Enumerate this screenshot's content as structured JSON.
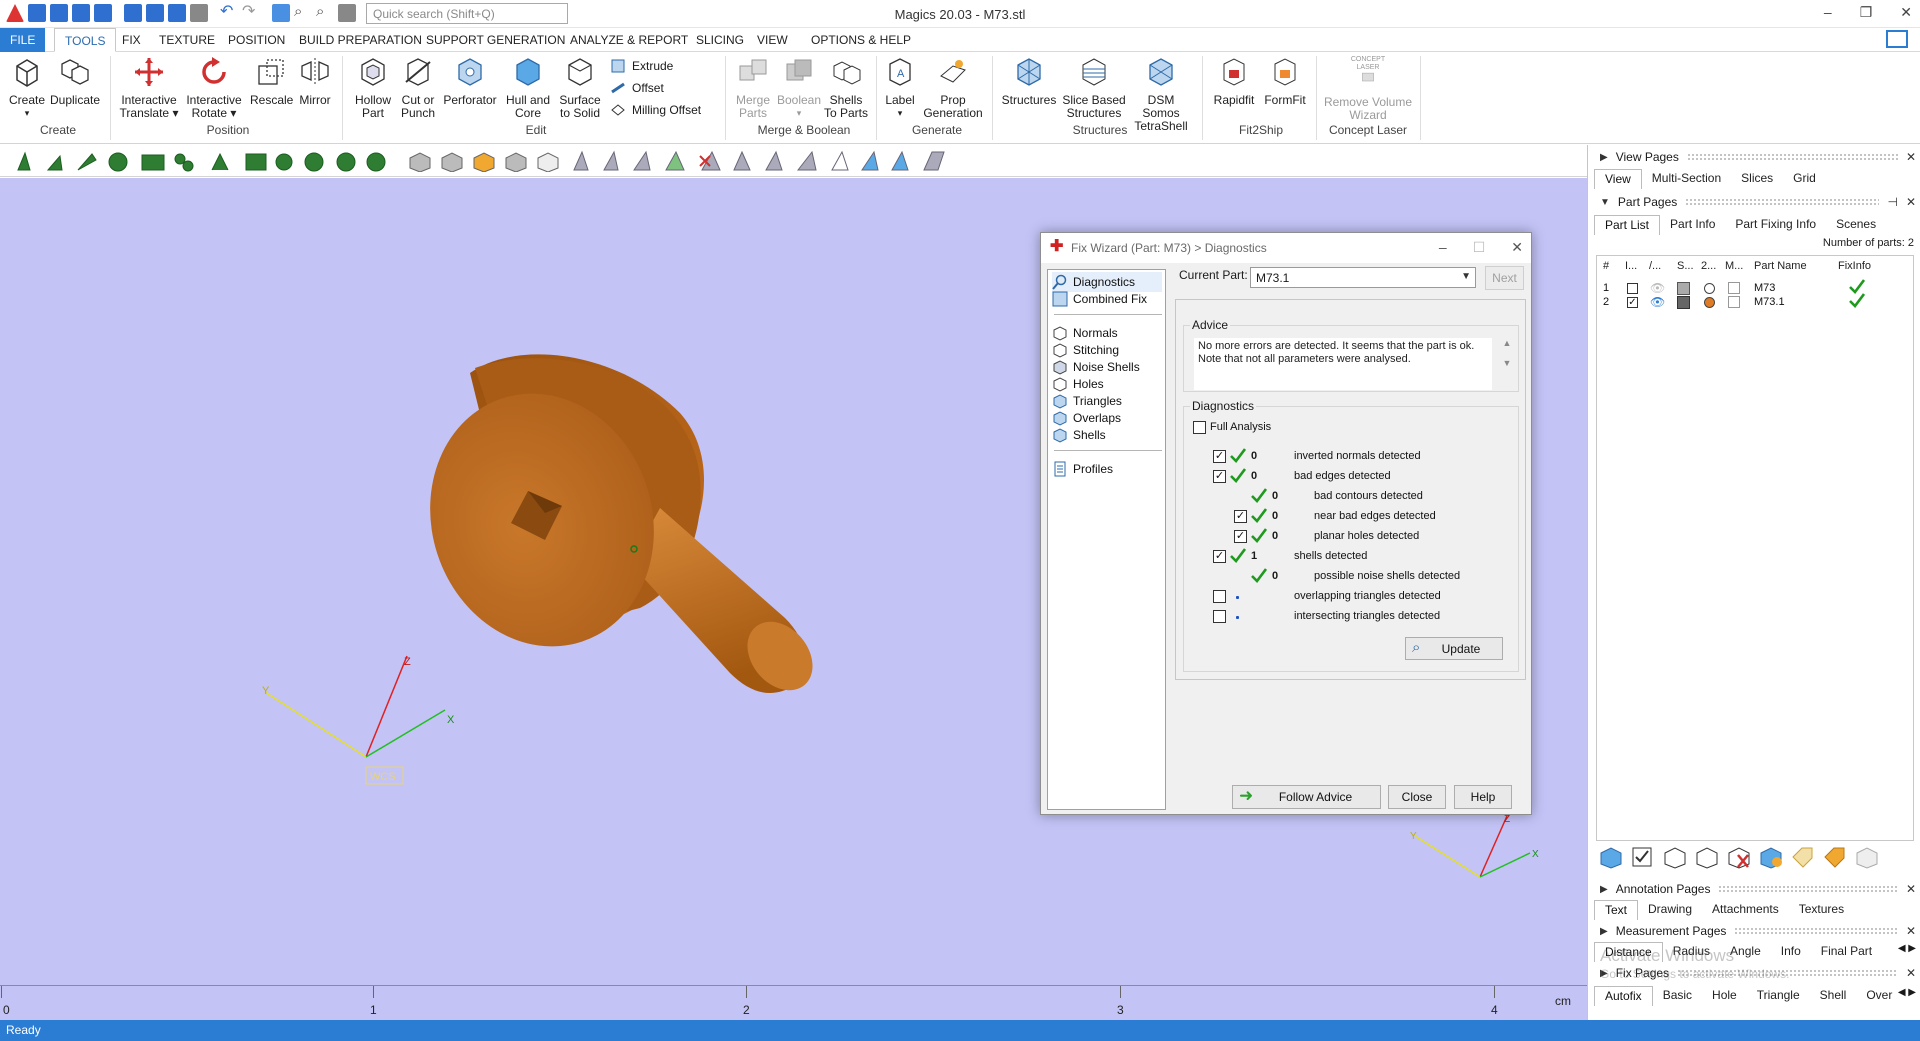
{
  "window": {
    "title": "Magics 20.03 - M73.stl",
    "search_placeholder": "Quick search (Shift+Q)"
  },
  "menu": {
    "tabs": [
      {
        "label": "FILE"
      },
      {
        "label": "TOOLS"
      },
      {
        "label": "FIX"
      },
      {
        "label": "TEXTURE"
      },
      {
        "label": "POSITION"
      },
      {
        "label": "BUILD PREPARATION"
      },
      {
        "label": "SUPPORT GENERATION"
      },
      {
        "label": "ANALYZE & REPORT"
      },
      {
        "label": "SLICING"
      },
      {
        "label": "VIEW"
      },
      {
        "label": "OPTIONS & HELP"
      }
    ],
    "active": "TOOLS"
  },
  "ribbon": {
    "buttons": [
      {
        "l1": "Create",
        "l2": ""
      },
      {
        "l1": "Duplicate",
        "l2": ""
      },
      {
        "l1": "Interactive",
        "l2": "Translate"
      },
      {
        "l1": "Interactive",
        "l2": "Rotate"
      },
      {
        "l1": "Rescale",
        "l2": ""
      },
      {
        "l1": "Mirror",
        "l2": ""
      },
      {
        "l1": "Hollow",
        "l2": "Part"
      },
      {
        "l1": "Cut or",
        "l2": "Punch"
      },
      {
        "l1": "Perforator",
        "l2": ""
      },
      {
        "l1": "Hull and",
        "l2": "Core"
      },
      {
        "l1": "Surface",
        "l2": "to Solid"
      },
      {
        "l1": "Merge",
        "l2": "Parts"
      },
      {
        "l1": "Boolean",
        "l2": ""
      },
      {
        "l1": "Shells",
        "l2": "To Parts"
      },
      {
        "l1": "Label",
        "l2": ""
      },
      {
        "l1": "Prop",
        "l2": "Generation"
      },
      {
        "l1": "Structures",
        "l2": ""
      },
      {
        "l1": "Slice Based",
        "l2": "Structures"
      },
      {
        "l1": "DSM Somos",
        "l2": "TetraShell"
      },
      {
        "l1": "Rapidfit",
        "l2": ""
      },
      {
        "l1": "FormFit",
        "l2": ""
      },
      {
        "l1": "Remove Volume",
        "l2": "Wizard"
      }
    ],
    "small": [
      "Extrude",
      "Offset",
      "Milling Offset"
    ],
    "concept_logo": "CONCEPT LASER",
    "groups": [
      "Create",
      "Position",
      "Edit",
      "Merge & Boolean",
      "Generate",
      "Structures",
      "Fit2Ship",
      "Concept Laser"
    ]
  },
  "viewport": {
    "bg": "#c3c3f6",
    "axes": {
      "z": "Z",
      "y": "Y",
      "x": "X",
      "wcs": "WCS"
    },
    "ruler": [
      "0",
      "1",
      "2",
      "3",
      "4"
    ],
    "unit": "cm"
  },
  "status": "Ready",
  "dialog": {
    "title": "Fix Wizard (Part: M73) > Diagnostics",
    "nav": [
      "Diagnostics",
      "Combined Fix",
      "Normals",
      "Stitching",
      "Noise Shells",
      "Holes",
      "Triangles",
      "Overlaps",
      "Shells",
      "Profiles"
    ],
    "current_part_label": "Current Part:",
    "current_part": "M73.1",
    "next": "Next",
    "advice_title": "Advice",
    "advice_text": "No more errors are detected. It seems that the part is ok. Note that not all parameters were analysed.",
    "diag_title": "Diagnostics",
    "full_analysis": "Full Analysis",
    "rows": [
      {
        "count": "0",
        "label": "inverted normals detected"
      },
      {
        "count": "0",
        "label": "bad edges detected"
      },
      {
        "count": "0",
        "label": "bad contours detected"
      },
      {
        "count": "0",
        "label": "near bad edges detected"
      },
      {
        "count": "0",
        "label": "planar holes detected"
      },
      {
        "count": "1",
        "label": "shells detected"
      },
      {
        "count": "0",
        "label": "possible noise shells detected"
      },
      {
        "count": "",
        "label": "overlapping triangles detected"
      },
      {
        "count": "",
        "label": "intersecting triangles detected"
      }
    ],
    "update": "Update",
    "follow_advice": "Follow Advice",
    "close": "Close",
    "help": "Help"
  },
  "right": {
    "view_pages": "View Pages",
    "view_tabs": [
      "View",
      "Multi-Section",
      "Slices",
      "Grid"
    ],
    "part_pages": "Part Pages",
    "part_tabs": [
      "Part List",
      "Part Info",
      "Part Fixing Info",
      "Scenes"
    ],
    "num_parts": "Number of parts: 2",
    "headers": [
      "#",
      "I...",
      "/...",
      "S...",
      "2...",
      "M...",
      "Part Name",
      "FixInfo"
    ],
    "rows": [
      {
        "n": "1",
        "name": "M73"
      },
      {
        "n": "2",
        "name": "M73.1"
      }
    ],
    "annotation_pages": "Annotation Pages",
    "annotation_tabs": [
      "Text",
      "Drawing",
      "Attachments",
      "Textures"
    ],
    "measurement_pages": "Measurement Pages",
    "measurement_tabs": [
      "Distance",
      "Radius",
      "Angle",
      "Info",
      "Final Part"
    ],
    "fix_pages": "Fix Pages",
    "fix_tabs": [
      "Autofix",
      "Basic",
      "Hole",
      "Triangle",
      "Shell",
      "Over"
    ],
    "watermark1": "Activate Windows",
    "watermark2": "Go to Settings to activate Windows."
  }
}
